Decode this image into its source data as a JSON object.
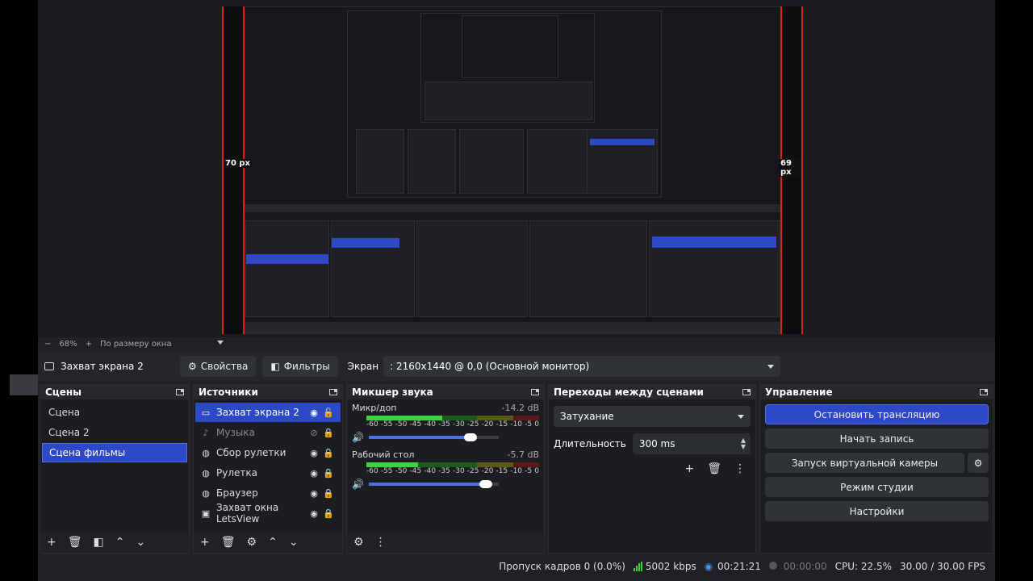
{
  "preview": {
    "left_px_label": "70 px",
    "right_px_label": "69 px"
  },
  "zoom_bar": {
    "minus": "−",
    "zoom": "68%",
    "plus": "+",
    "fit_label": "По размеру окна"
  },
  "source_bar": {
    "source_name": "Захват экрана 2",
    "properties_label": "Свойства",
    "filters_label": "Фильтры",
    "screen_label": "Экран",
    "screen_value": ": 2160x1440 @ 0,0 (Основной монитор)"
  },
  "scenes": {
    "title": "Сцены",
    "items": [
      "Сцена",
      "Сцена 2",
      "Сцена фильмы"
    ],
    "active_index": 2
  },
  "sources": {
    "title": "Источники",
    "items": [
      {
        "label": "Захват экрана 2",
        "icon": "monitor-icon",
        "active": true,
        "visible": true
      },
      {
        "label": "Музыка",
        "icon": "music-icon",
        "active": false,
        "visible": false
      },
      {
        "label": "Сбор рулетки",
        "icon": "globe-icon",
        "active": false,
        "visible": true
      },
      {
        "label": "Рулетка",
        "icon": "globe-icon",
        "active": false,
        "visible": true
      },
      {
        "label": "Браузер",
        "icon": "globe-icon",
        "active": false,
        "visible": true
      },
      {
        "label": "Захват окна LetsView",
        "icon": "window-icon",
        "active": false,
        "visible": true
      }
    ]
  },
  "mixer": {
    "title": "Микшер звука",
    "channels": [
      {
        "name": "Микр/доп",
        "db": "-14.2 dB",
        "level": 0.44,
        "volume": 0.78
      },
      {
        "name": "Рабочий стол",
        "db": "-5.7 dB",
        "level": 0.3,
        "volume": 0.9
      }
    ],
    "scale": [
      "-60",
      "-55",
      "-50",
      "-45",
      "-40",
      "-35",
      "-30",
      "-25",
      "-20",
      "-15",
      "-10",
      "-5",
      "0"
    ]
  },
  "transitions": {
    "title": "Переходы между сценами",
    "selected": "Затухание",
    "duration_label": "Длительность",
    "duration_value": "300 ms"
  },
  "controls": {
    "title": "Управление",
    "stop_stream": "Остановить трансляцию",
    "start_record": "Начать запись",
    "virtual_cam": "Запуск виртуальной камеры",
    "studio_mode": "Режим студии",
    "settings": "Настройки"
  },
  "status": {
    "dropped": "Пропуск кадров 0 (0.0%)",
    "bitrate": "5002 kbps",
    "stream_time": "00:21:21",
    "record_time": "00:00:00",
    "cpu": "CPU: 22.5%",
    "fps": "30.00 / 30.00 FPS"
  },
  "colors": {
    "accent": "#2d49c8",
    "guide_red": "#e02020",
    "meter_green": "#3cd63c"
  }
}
